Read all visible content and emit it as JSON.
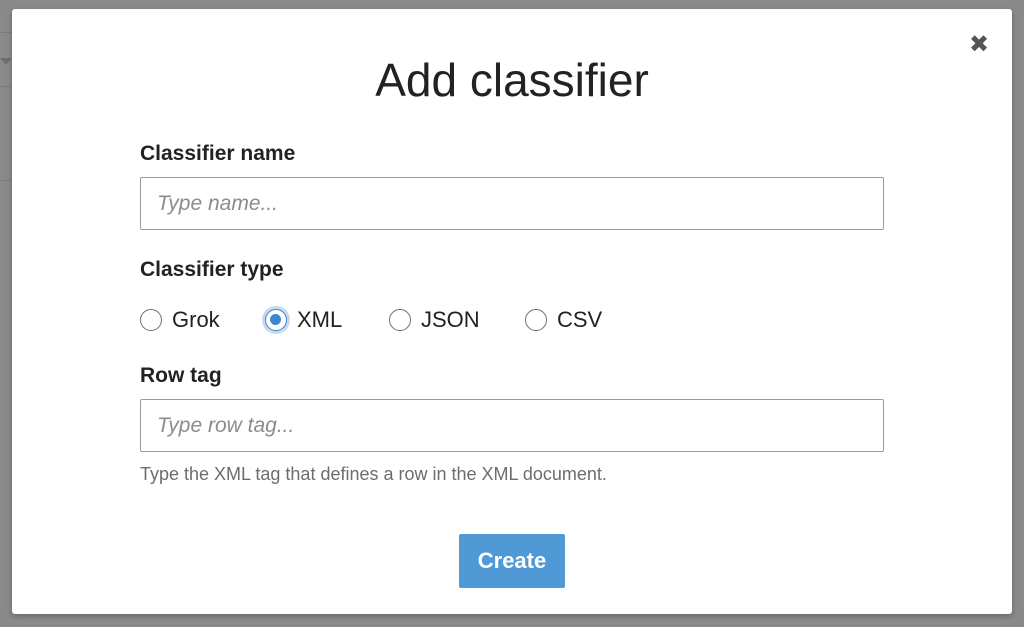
{
  "dialog": {
    "title": "Add classifier",
    "close_icon": "close-icon",
    "close_glyph": "✖"
  },
  "form": {
    "name_label": "Classifier name",
    "name_placeholder": "Type name...",
    "name_value": "",
    "type_label": "Classifier type",
    "type_options": [
      {
        "label": "Grok",
        "checked": false
      },
      {
        "label": "XML",
        "checked": true
      },
      {
        "label": "JSON",
        "checked": false
      },
      {
        "label": "CSV",
        "checked": false
      }
    ],
    "row_tag_label": "Row tag",
    "row_tag_placeholder": "Type row tag...",
    "row_tag_value": "",
    "row_tag_hint": "Type the XML tag that defines a row in the XML document.",
    "create_label": "Create"
  },
  "colors": {
    "primary_button": "#4f9ad6",
    "radio_selected": "#3b87cf",
    "backdrop": "#8a8a8a"
  }
}
